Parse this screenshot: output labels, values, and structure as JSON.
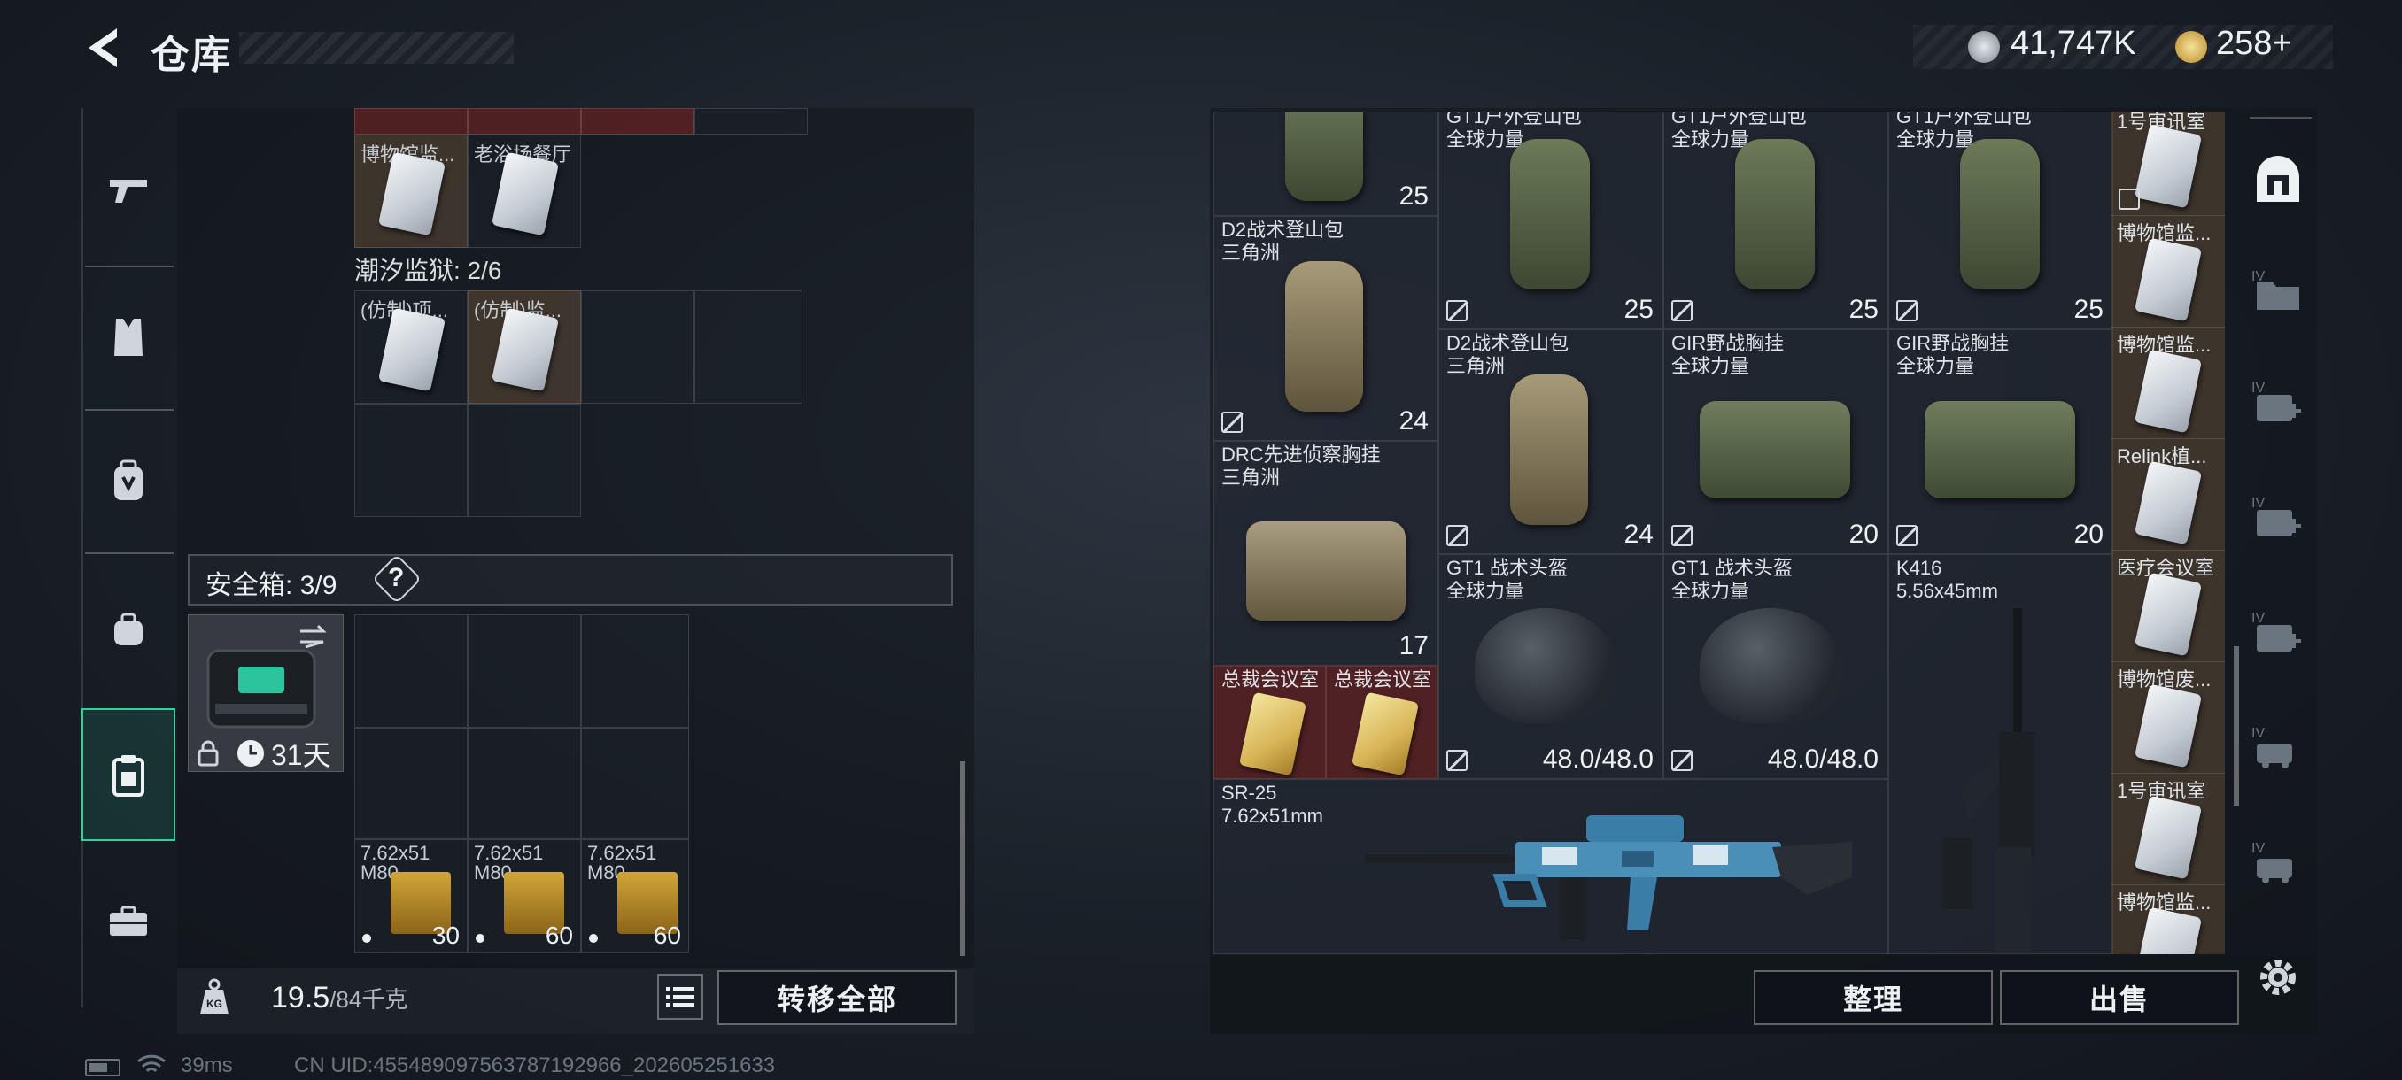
{
  "header": {
    "title": "仓库",
    "currency": [
      {
        "icon": "coin-icon",
        "value": "41,747K"
      },
      {
        "icon": "token-icon",
        "value": "258+"
      }
    ]
  },
  "left_nav": [
    {
      "icon": "gun-icon",
      "active": false
    },
    {
      "icon": "vest-icon",
      "active": false
    },
    {
      "icon": "backpack-icon",
      "active": false
    },
    {
      "icon": "bag-icon",
      "active": false
    },
    {
      "icon": "clipboard-icon",
      "active": true
    },
    {
      "icon": "toolbox-icon",
      "active": false
    }
  ],
  "left_panel": {
    "top_cards": [
      "博物馆监...",
      "老浴场餐厅"
    ],
    "prison_label": "潮汐监狱: 2/6",
    "prison_cards": [
      "(仿制)项...",
      "(仿制)监..."
    ],
    "safebox_label": "安全箱: 3/9",
    "safebox_help": "?",
    "safebox_days": "31天",
    "ammo": [
      {
        "name_line1": "7.62x51",
        "name_line2": "M80",
        "count": "30"
      },
      {
        "name_line1": "7.62x51",
        "name_line2": "M80",
        "count": "60"
      },
      {
        "name_line1": "7.62x51",
        "name_line2": "M80",
        "count": "60"
      }
    ],
    "weight_current": "19.5",
    "weight_max": "/84千克",
    "transfer_all": "转移全部"
  },
  "right_panel": {
    "items": {
      "bag_top_left_count": "25",
      "gt1_bag_1": {
        "name": "GT1户外登山包",
        "sub": "全球力量",
        "count": "25"
      },
      "gt1_bag_2": {
        "name": "GT1户外登山包",
        "sub": "全球力量",
        "count": "25"
      },
      "gt1_bag_3": {
        "name": "GT1户外登山包",
        "sub": "全球力量",
        "count": "25"
      },
      "d2_bag_1": {
        "name": "D2战术登山包",
        "sub": "三角洲",
        "count": "24"
      },
      "d2_bag_2": {
        "name": "D2战术登山包",
        "sub": "三角洲",
        "count": "24"
      },
      "gir_vest_1": {
        "name": "GIR野战胸挂",
        "sub": "全球力量",
        "count": "20"
      },
      "gir_vest_2": {
        "name": "GIR野战胸挂",
        "sub": "全球力量",
        "count": "20"
      },
      "drc_vest": {
        "name": "DRC先进侦察胸挂",
        "sub": "三角洲",
        "count": "17"
      },
      "helmet_1": {
        "name": "GT1 战术头盔",
        "sub": "全球力量",
        "durability": "48.0/48.0"
      },
      "helmet_2": {
        "name": "GT1 战术头盔",
        "sub": "全球力量",
        "durability": "48.0/48.0"
      },
      "k416": {
        "name": "K416",
        "sub": "5.56x45mm"
      },
      "sr25": {
        "name": "SR-25",
        "sub": "7.62x51mm"
      },
      "president_card_1": "总裁会议室",
      "president_card_2": "总裁会议室"
    },
    "side_column": [
      "1号审讯室",
      "博物馆监...",
      "博物馆监...",
      "Relink植...",
      "医疗会议室",
      "博物馆废...",
      "1号审讯室",
      "博物馆监..."
    ],
    "sort_label": "整理",
    "sell_label": "出售"
  },
  "right_nav": [
    "safe-icon",
    "folder-icon",
    "medkit-plus-icon",
    "medkit-plus-icon",
    "medkit-plus-icon",
    "car-icon",
    "car-icon",
    "gear-icon"
  ],
  "right_nav_tier": "IV",
  "status_bar": {
    "ping": "39ms",
    "uid": "CN UID:455489097563787192966_202605251633"
  },
  "colors": {
    "accent": "#2bd49a",
    "gold": "#d8b455",
    "red_cell": "#6e2323"
  }
}
